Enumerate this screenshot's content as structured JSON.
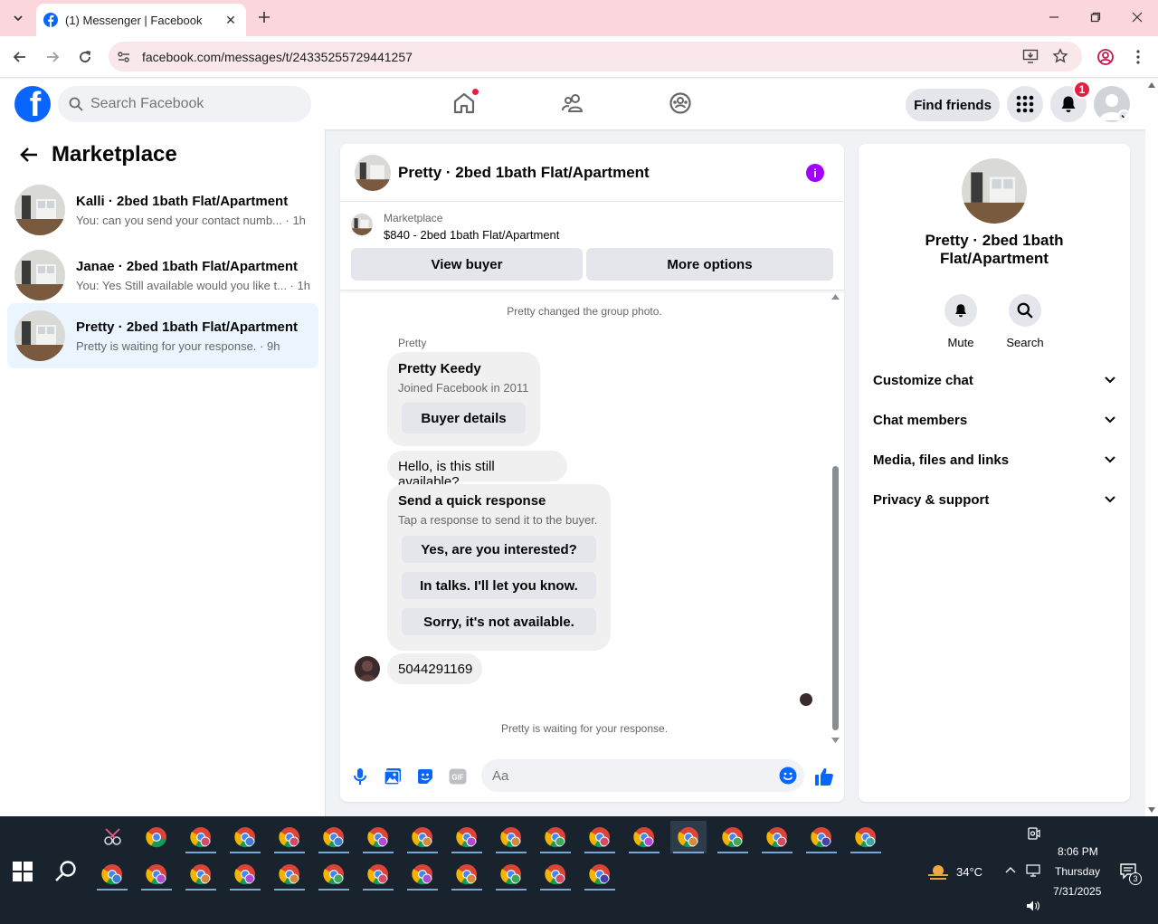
{
  "browser": {
    "tab_title": "(1) Messenger | Facebook",
    "url": "facebook.com/messages/t/24335255729441257"
  },
  "header": {
    "search_placeholder": "Search Facebook",
    "find_friends": "Find friends",
    "notification_count": "1"
  },
  "sidebar": {
    "title": "Marketplace",
    "conversations": [
      {
        "name": "Kalli · 2bed 1bath Flat/Apartment",
        "preview": "You: can you send your contact numb... · 1h",
        "active": false
      },
      {
        "name": "Janae · 2bed 1bath Flat/Apartment",
        "preview": "You: Yes Still available would you like t... · 1h",
        "active": false
      },
      {
        "name": "Pretty · 2bed 1bath Flat/Apartment",
        "preview": "Pretty is waiting for your response. · 9h",
        "active": true
      }
    ]
  },
  "chat": {
    "title": "Pretty · 2bed 1bath Flat/Apartment",
    "marketplace_label": "Marketplace",
    "listing": "$840 - 2bed 1bath Flat/Apartment",
    "view_buyer": "View buyer",
    "more_options": "More options",
    "system_photo": "Pretty changed the group photo.",
    "sender": "Pretty",
    "buyer_card": {
      "name": "Pretty Keedy",
      "joined": "Joined Facebook in 2011",
      "button": "Buyer details"
    },
    "message_1": "Hello, is this still available?",
    "quick_response": {
      "title": "Send a quick response",
      "subtitle": "Tap a response to send it to the buyer.",
      "options": [
        "Yes, are you interested?",
        "In talks. I'll let you know.",
        "Sorry, it's not available."
      ]
    },
    "message_2": "5044291169",
    "waiting": "Pretty is waiting for your response.",
    "composer_placeholder": "Aa"
  },
  "info": {
    "name": "Pretty · 2bed 1bath Flat/Apartment",
    "mute": "Mute",
    "search": "Search",
    "sections": [
      "Customize chat",
      "Chat members",
      "Media, files and links",
      "Privacy & support"
    ]
  },
  "taskbar": {
    "temperature": "34°C",
    "time": "8:06 PM",
    "day": "Thursday",
    "date": "7/31/2025",
    "notif_count": "3"
  },
  "colors": {
    "fb_blue": "#0866ff",
    "messenger_purple": "#a100ff",
    "badge_red": "#e41e3f",
    "tab_bar": "#fbd7dd"
  }
}
